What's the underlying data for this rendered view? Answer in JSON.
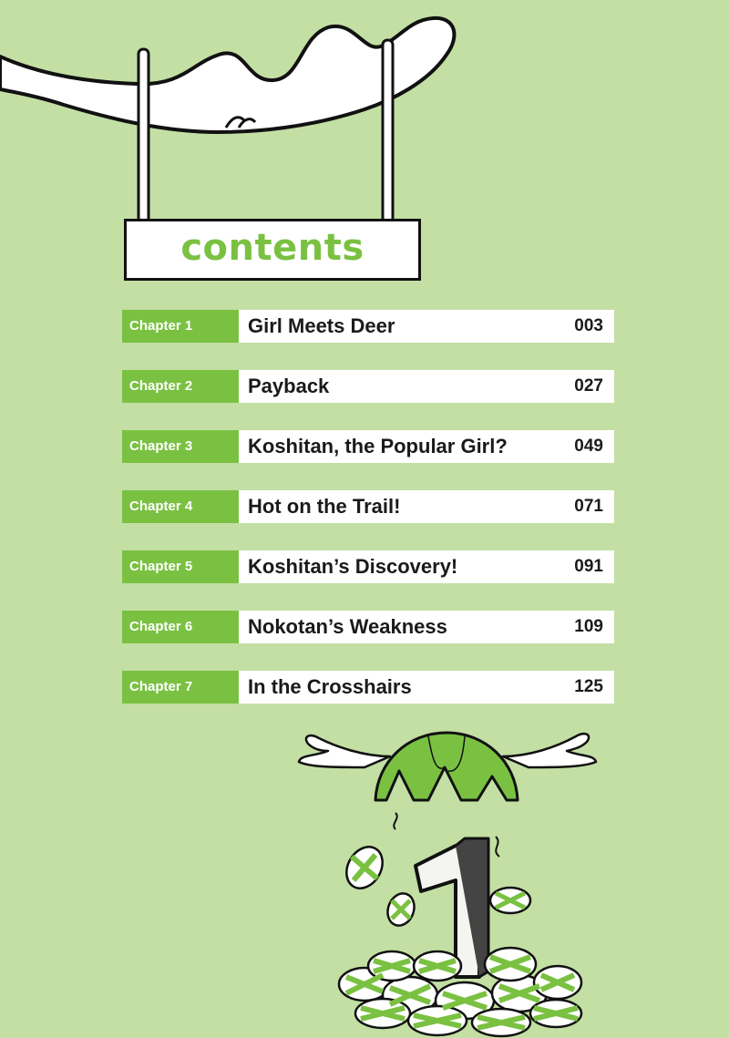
{
  "colors": {
    "background": "#c3dfa4",
    "accent": "#7ac142",
    "ink": "#111111",
    "bar": "#ffffff"
  },
  "header": {
    "title": "contents"
  },
  "chapters": [
    {
      "label": "Chapter 1",
      "title": "Girl Meets Deer",
      "page": "003"
    },
    {
      "label": "Chapter 2",
      "title": "Payback",
      "page": "027"
    },
    {
      "label": "Chapter 3",
      "title": "Koshitan, the Popular Girl?",
      "page": "049"
    },
    {
      "label": "Chapter 4",
      "title": "Hot on the Trail!",
      "page": "071"
    },
    {
      "label": "Chapter 5",
      "title": "Koshitan’s Discovery!",
      "page": "091"
    },
    {
      "label": "Chapter 6",
      "title": "Nokotan’s Weakness",
      "page": "109"
    },
    {
      "label": "Chapter 7",
      "title": "In the Crosshairs",
      "page": "125"
    }
  ]
}
